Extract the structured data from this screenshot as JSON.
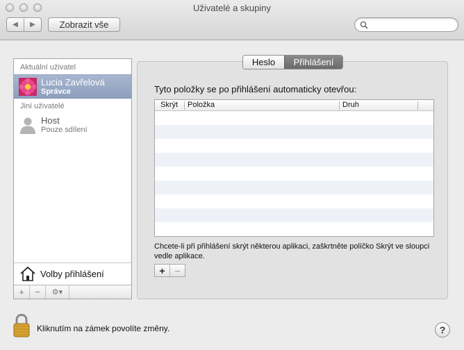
{
  "window": {
    "title": "Uživatelé a skupiny"
  },
  "toolbar": {
    "back_glyph": "◀",
    "forward_glyph": "▶",
    "show_all_label": "Zobrazit vše",
    "search_value": "",
    "search_placeholder": ""
  },
  "sidebar": {
    "current_user_header": "Aktuální uživatel",
    "current_user": {
      "name": "Lucia Zavřelová",
      "role": "Správce",
      "avatar_icon": "flower-icon"
    },
    "other_users_header": "Jiní uživatelé",
    "other_users": [
      {
        "name": "Host",
        "role": "Pouze sdílení",
        "avatar_icon": "person-icon"
      }
    ],
    "login_options_label": "Volby přihlášení",
    "tools": {
      "add": "+",
      "remove": "−",
      "gear": "⚙▾"
    }
  },
  "tabs": [
    {
      "label": "Heslo",
      "active": false
    },
    {
      "label": "Přihlášení",
      "active": true
    }
  ],
  "main": {
    "heading": "Tyto položky se po přihlášení automaticky otevřou:",
    "table": {
      "columns": [
        "Skrýt",
        "Položka",
        "Druh"
      ],
      "rows": []
    },
    "hint": "Chcete-li při přihlášení skrýt některou aplikaci, zaškrtněte políčko Skrýt ve sloupci vedle aplikace.",
    "table_tools": {
      "add": "+",
      "remove": "−"
    }
  },
  "footer": {
    "lock_text": "Kliknutím na zámek povolíte změny.",
    "help_glyph": "?"
  },
  "colors": {
    "selection": "#98a8c4",
    "active_tab": "#7a7a7a",
    "stripe": "#eef2f8"
  }
}
